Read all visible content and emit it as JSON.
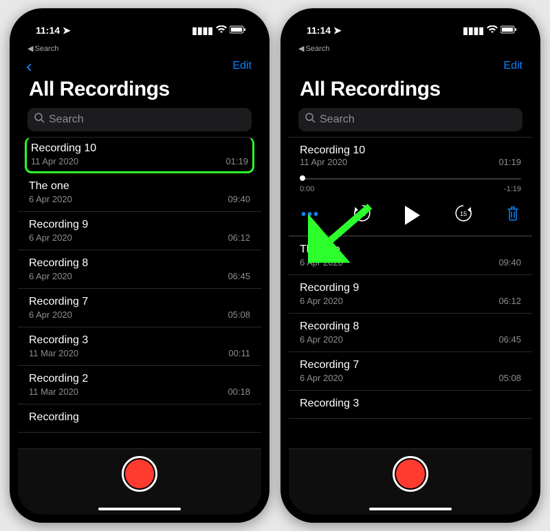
{
  "status": {
    "time": "11:14",
    "back_label": "Search"
  },
  "nav": {
    "edit": "Edit"
  },
  "title": "All Recordings",
  "search": {
    "placeholder": "Search"
  },
  "left_phone": {
    "recordings": [
      {
        "name": "Recording 10",
        "date": "11 Apr 2020",
        "duration": "01:19",
        "highlighted": true
      },
      {
        "name": "The one",
        "date": "6 Apr 2020",
        "duration": "09:40"
      },
      {
        "name": "Recording 9",
        "date": "6 Apr 2020",
        "duration": "06:12"
      },
      {
        "name": "Recording 8",
        "date": "6 Apr 2020",
        "duration": "06:45"
      },
      {
        "name": "Recording 7",
        "date": "6 Apr 2020",
        "duration": "05:08"
      },
      {
        "name": "Recording 3",
        "date": "11 Mar 2020",
        "duration": "00:11"
      },
      {
        "name": "Recording 2",
        "date": "11 Mar 2020",
        "duration": "00:18"
      },
      {
        "name": "Recording",
        "date": "",
        "duration": ""
      }
    ]
  },
  "right_phone": {
    "expanded": {
      "name": "Recording 10",
      "date": "11 Apr 2020",
      "duration": "01:19",
      "elapsed": "0:00",
      "remaining": "-1:19",
      "skip_seconds": "15"
    },
    "recordings": [
      {
        "name": "The one",
        "date": "6 Apr 2020",
        "duration": "09:40"
      },
      {
        "name": "Recording 9",
        "date": "6 Apr 2020",
        "duration": "06:12"
      },
      {
        "name": "Recording 8",
        "date": "6 Apr 2020",
        "duration": "06:45"
      },
      {
        "name": "Recording 7",
        "date": "6 Apr 2020",
        "duration": "05:08"
      },
      {
        "name": "Recording 3",
        "date": "",
        "duration": ""
      }
    ]
  },
  "colors": {
    "accent_blue": "#0a84ff",
    "record_red": "#ff3b30",
    "highlight_green": "#2cff2c"
  }
}
